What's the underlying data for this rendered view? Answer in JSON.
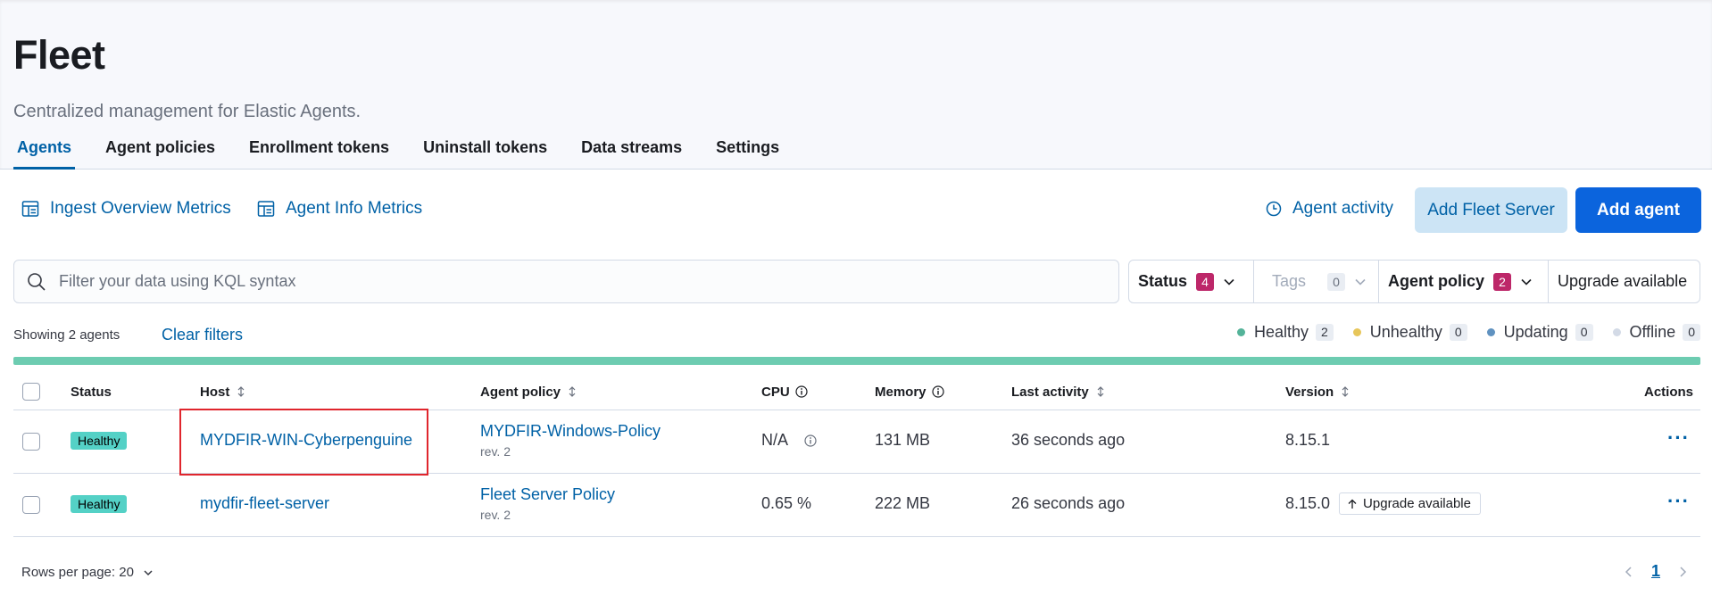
{
  "page": {
    "title": "Fleet",
    "subtitle": "Centralized management for Elastic Agents."
  },
  "tabs": [
    {
      "label": "Agents",
      "active": true
    },
    {
      "label": "Agent policies"
    },
    {
      "label": "Enrollment tokens"
    },
    {
      "label": "Uninstall tokens"
    },
    {
      "label": "Data streams"
    },
    {
      "label": "Settings"
    }
  ],
  "toolbar": {
    "ingest_metrics": "Ingest Overview Metrics",
    "agent_info_metrics": "Agent Info Metrics",
    "agent_activity": "Agent activity",
    "add_fleet_server": "Add Fleet Server",
    "add_agent": "Add agent"
  },
  "search": {
    "placeholder": "Filter your data using KQL syntax",
    "value": ""
  },
  "filters": {
    "status": {
      "label": "Status",
      "count": "4"
    },
    "tags": {
      "label": "Tags",
      "count": "0"
    },
    "agent_policy": {
      "label": "Agent policy",
      "count": "2"
    },
    "upgrade_available": {
      "label": "Upgrade available"
    }
  },
  "summary": {
    "showing": "Showing 2 agents",
    "clear_filters": "Clear filters"
  },
  "legend": [
    {
      "label": "Healthy",
      "count": "2",
      "color": "#54b399"
    },
    {
      "label": "Unhealthy",
      "count": "0",
      "color": "#e7c65a"
    },
    {
      "label": "Updating",
      "count": "0",
      "color": "#6092c0"
    },
    {
      "label": "Offline",
      "count": "0",
      "color": "#d3dae6"
    }
  ],
  "status_bar": {
    "healthy_fraction": 1.0,
    "color": "#6dccb1"
  },
  "table": {
    "headers": {
      "status": "Status",
      "host": "Host",
      "agent_policy": "Agent policy",
      "cpu": "CPU",
      "memory": "Memory",
      "last_activity": "Last activity",
      "version": "Version",
      "actions": "Actions"
    },
    "rows": [
      {
        "status": "Healthy",
        "host": "MYDFIR-WIN-Cyberpenguine",
        "policy": "MYDFIR-Windows-Policy",
        "rev": "rev. 2",
        "cpu": "N/A",
        "memory": "131 MB",
        "last_activity": "36 seconds ago",
        "version": "8.15.1",
        "upgrade": ""
      },
      {
        "status": "Healthy",
        "host": "mydfir-fleet-server",
        "policy": "Fleet Server Policy",
        "rev": "rev. 2",
        "cpu": "0.65 %",
        "memory": "222 MB",
        "last_activity": "26 seconds ago",
        "version": "8.15.0",
        "upgrade": "Upgrade available"
      }
    ]
  },
  "footer": {
    "rows_per_page": "Rows per page: 20",
    "current_page": "1"
  }
}
